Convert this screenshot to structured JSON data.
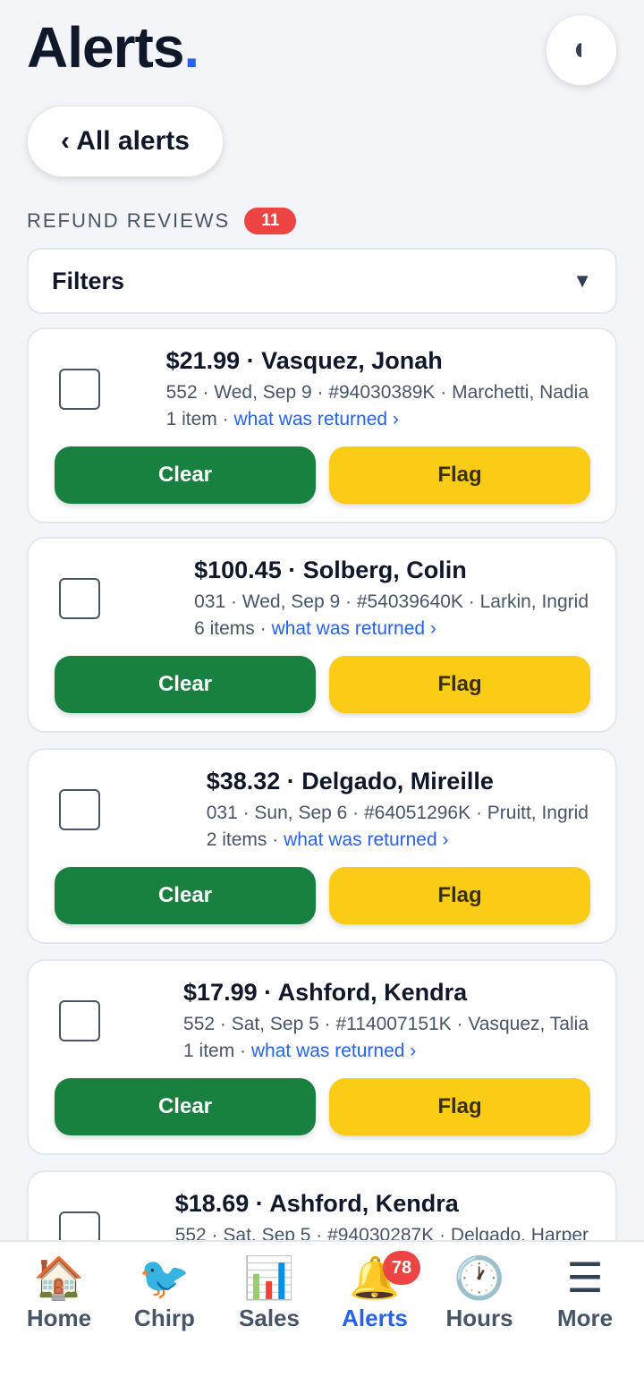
{
  "header": {
    "title": "Alerts",
    "title_dot": ".",
    "theme_toggle_icon": "half-moon-icon",
    "back_label": "‹ All alerts"
  },
  "section": {
    "label": "REFUND REVIEWS",
    "count": "11"
  },
  "filters": {
    "label": "Filters",
    "caret": "▼"
  },
  "cards": [
    {
      "headline": "$21.99 · Vasquez, Jonah",
      "meta": "552 · Wed, Sep 9 · #94030389K · Marchetti, Nadia",
      "items": "1 item · ",
      "link": "what was returned ›",
      "clear": "Clear",
      "flag": "Flag"
    },
    {
      "headline": "$100.45 · Solberg, Colin",
      "meta": "031 · Wed, Sep 9 · #54039640K · Larkin, Ingrid",
      "items": "6 items · ",
      "link": "what was returned ›",
      "clear": "Clear",
      "flag": "Flag"
    },
    {
      "headline": "$38.32 · Delgado, Mireille",
      "meta": "031 · Sun, Sep 6 · #64051296K · Pruitt, Ingrid",
      "items": "2 items · ",
      "link": "what was returned ›",
      "clear": "Clear",
      "flag": "Flag"
    },
    {
      "headline": "$17.99 · Ashford, Kendra",
      "meta": "552 · Sat, Sep 5 · #114007151K · Vasquez, Talia",
      "items": "1 item · ",
      "link": "what was returned ›",
      "clear": "Clear",
      "flag": "Flag"
    },
    {
      "headline": "$18.69 · Ashford, Kendra",
      "meta": "552 · Sat, Sep 5 · #94030287K · Delgado, Harper",
      "items": "",
      "link": "",
      "clear": "",
      "flag": ""
    }
  ],
  "nav": [
    {
      "label": "Home",
      "icon": "🏠",
      "icon_name": "home-icon"
    },
    {
      "label": "Chirp",
      "icon": "🐦",
      "icon_name": "bird-icon"
    },
    {
      "label": "Sales",
      "icon": "📊",
      "icon_name": "bar-chart-icon"
    },
    {
      "label": "Alerts",
      "icon": "🔔",
      "icon_name": "bell-icon",
      "badge": "78",
      "active": true
    },
    {
      "label": "Hours",
      "icon": "🕐",
      "icon_name": "clock-icon"
    },
    {
      "label": "More",
      "icon": "☰",
      "icon_name": "menu-icon"
    }
  ],
  "colors": {
    "accent": "#2563eb",
    "clear_button": "#188140",
    "flag_button": "#facc15",
    "badge": "#ef4444"
  }
}
